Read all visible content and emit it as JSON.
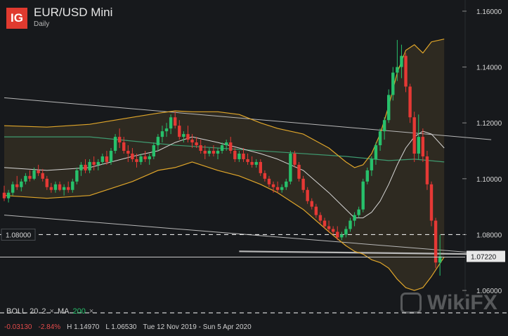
{
  "header": {
    "logo": "IG",
    "title": "EUR/USD Mini",
    "timeframe": "Daily"
  },
  "indicators": {
    "boll_name": "BOLL",
    "boll_period": "20",
    "boll_dev": "2",
    "ma_name": "MA",
    "ma_period": "200",
    "remove_symbol": "×"
  },
  "stats": {
    "change": "-0.03130",
    "change_pct": "-2.84%",
    "high": "H 1.14970",
    "low": "L 1.06530",
    "range": "Tue 12 Nov 2019 - Sun 5 Apr 2020"
  },
  "watermark": "WikiFX",
  "colors": {
    "background": "#17191c",
    "up": "#27c06b",
    "down": "#e53935",
    "band": "#e0a62a",
    "ma": "#3f9a70",
    "mid": "#d6d6d6",
    "trendline": "#b8b8b8"
  },
  "chart_data": {
    "type": "candlestick",
    "instrument": "EUR/USD Mini",
    "timeframe": "Daily",
    "y_axis": {
      "ticks": [
        "1.16000",
        "1.14000",
        "1.12000",
        "1.10000",
        "1.08000",
        "1.06000"
      ],
      "ylim": [
        1.056,
        1.164
      ]
    },
    "price_labels": {
      "left_level": "1.08000",
      "current": "1.07220"
    },
    "levels": [
      1.08
    ],
    "candles": [
      [
        1.095,
        1.0975,
        1.092,
        1.093
      ],
      [
        1.093,
        1.096,
        1.0915,
        1.095
      ],
      [
        1.095,
        1.099,
        1.094,
        1.098
      ],
      [
        1.098,
        1.101,
        1.096,
        1.097
      ],
      [
        1.097,
        1.1,
        1.0955,
        1.099
      ],
      [
        1.099,
        1.102,
        1.098,
        1.101
      ],
      [
        1.101,
        1.103,
        1.099,
        1.1
      ],
      [
        1.1,
        1.104,
        1.0995,
        1.103
      ],
      [
        1.103,
        1.105,
        1.101,
        1.102
      ],
      [
        1.102,
        1.1035,
        1.099,
        1.1
      ],
      [
        1.1,
        1.101,
        1.096,
        1.097
      ],
      [
        1.097,
        1.0985,
        1.095,
        1.096
      ],
      [
        1.096,
        1.099,
        1.095,
        1.098
      ],
      [
        1.098,
        1.099,
        1.0955,
        1.096
      ],
      [
        1.096,
        1.098,
        1.094,
        1.097
      ],
      [
        1.097,
        1.099,
        1.095,
        1.096
      ],
      [
        1.096,
        1.1,
        1.095,
        1.099
      ],
      [
        1.099,
        1.104,
        1.098,
        1.103
      ],
      [
        1.103,
        1.106,
        1.101,
        1.105
      ],
      [
        1.105,
        1.107,
        1.102,
        1.103
      ],
      [
        1.103,
        1.107,
        1.102,
        1.106
      ],
      [
        1.106,
        1.108,
        1.103,
        1.105
      ],
      [
        1.105,
        1.107,
        1.103,
        1.106
      ],
      [
        1.106,
        1.109,
        1.105,
        1.108
      ],
      [
        1.108,
        1.11,
        1.105,
        1.106
      ],
      [
        1.106,
        1.111,
        1.105,
        1.11
      ],
      [
        1.11,
        1.116,
        1.109,
        1.115
      ],
      [
        1.115,
        1.118,
        1.111,
        1.113
      ],
      [
        1.113,
        1.115,
        1.109,
        1.11
      ],
      [
        1.11,
        1.112,
        1.106,
        1.109
      ],
      [
        1.109,
        1.111,
        1.106,
        1.107
      ],
      [
        1.107,
        1.109,
        1.104,
        1.106
      ],
      [
        1.106,
        1.109,
        1.105,
        1.108
      ],
      [
        1.108,
        1.11,
        1.106,
        1.107
      ],
      [
        1.107,
        1.109,
        1.105,
        1.108
      ],
      [
        1.108,
        1.113,
        1.107,
        1.112
      ],
      [
        1.112,
        1.116,
        1.11,
        1.115
      ],
      [
        1.115,
        1.119,
        1.113,
        1.117
      ],
      [
        1.117,
        1.12,
        1.115,
        1.118
      ],
      [
        1.118,
        1.123,
        1.116,
        1.122
      ],
      [
        1.122,
        1.124,
        1.118,
        1.119
      ],
      [
        1.119,
        1.121,
        1.114,
        1.115
      ],
      [
        1.115,
        1.117,
        1.113,
        1.116
      ],
      [
        1.116,
        1.119,
        1.113,
        1.114
      ],
      [
        1.114,
        1.116,
        1.111,
        1.113
      ],
      [
        1.113,
        1.115,
        1.111,
        1.112
      ],
      [
        1.112,
        1.114,
        1.109,
        1.11
      ],
      [
        1.11,
        1.112,
        1.107,
        1.109
      ],
      [
        1.109,
        1.111,
        1.108,
        1.11
      ],
      [
        1.11,
        1.112,
        1.108,
        1.109
      ],
      [
        1.109,
        1.111,
        1.107,
        1.11
      ],
      [
        1.11,
        1.113,
        1.109,
        1.112
      ],
      [
        1.112,
        1.114,
        1.11,
        1.113
      ],
      [
        1.113,
        1.115,
        1.109,
        1.11
      ],
      [
        1.11,
        1.111,
        1.106,
        1.107
      ],
      [
        1.107,
        1.11,
        1.106,
        1.109
      ],
      [
        1.109,
        1.111,
        1.106,
        1.107
      ],
      [
        1.107,
        1.109,
        1.105,
        1.106
      ],
      [
        1.106,
        1.108,
        1.104,
        1.105
      ],
      [
        1.105,
        1.107,
        1.104,
        1.106
      ],
      [
        1.106,
        1.107,
        1.101,
        1.102
      ],
      [
        1.102,
        1.103,
        1.099,
        1.1
      ],
      [
        1.1,
        1.101,
        1.097,
        1.098
      ],
      [
        1.098,
        1.099,
        1.095,
        1.097
      ],
      [
        1.097,
        1.099,
        1.095,
        1.096
      ],
      [
        1.096,
        1.098,
        1.095,
        1.097
      ],
      [
        1.097,
        1.1,
        1.096,
        1.099
      ],
      [
        1.099,
        1.11,
        1.098,
        1.109
      ],
      [
        1.109,
        1.11,
        1.104,
        1.105
      ],
      [
        1.105,
        1.106,
        1.099,
        1.1
      ],
      [
        1.1,
        1.101,
        1.095,
        1.096
      ],
      [
        1.096,
        1.097,
        1.091,
        1.092
      ],
      [
        1.092,
        1.093,
        1.089,
        1.09
      ],
      [
        1.09,
        1.091,
        1.086,
        1.087
      ],
      [
        1.087,
        1.088,
        1.084,
        1.085
      ],
      [
        1.085,
        1.086,
        1.082,
        1.083
      ],
      [
        1.083,
        1.085,
        1.081,
        1.082
      ],
      [
        1.082,
        1.083,
        1.08,
        1.081
      ],
      [
        1.081,
        1.083,
        1.078,
        1.079
      ],
      [
        1.079,
        1.081,
        1.078,
        1.08
      ],
      [
        1.08,
        1.083,
        1.079,
        1.082
      ],
      [
        1.082,
        1.086,
        1.081,
        1.085
      ],
      [
        1.085,
        1.088,
        1.083,
        1.087
      ],
      [
        1.087,
        1.09,
        1.086,
        1.089
      ],
      [
        1.089,
        1.1,
        1.088,
        1.099
      ],
      [
        1.099,
        1.104,
        1.098,
        1.103
      ],
      [
        1.103,
        1.108,
        1.101,
        1.107
      ],
      [
        1.107,
        1.113,
        1.105,
        1.112
      ],
      [
        1.112,
        1.118,
        1.11,
        1.117
      ],
      [
        1.117,
        1.122,
        1.114,
        1.121
      ],
      [
        1.121,
        1.132,
        1.12,
        1.13
      ],
      [
        1.13,
        1.14,
        1.128,
        1.138
      ],
      [
        1.138,
        1.1497,
        1.135,
        1.14
      ],
      [
        1.14,
        1.148,
        1.136,
        1.144
      ],
      [
        1.144,
        1.145,
        1.131,
        1.133
      ],
      [
        1.133,
        1.134,
        1.12,
        1.122
      ],
      [
        1.122,
        1.124,
        1.106,
        1.109
      ],
      [
        1.109,
        1.123,
        1.107,
        1.115
      ],
      [
        1.115,
        1.118,
        1.106,
        1.108
      ],
      [
        1.108,
        1.11,
        1.096,
        1.098
      ],
      [
        1.098,
        1.099,
        1.083,
        1.085
      ],
      [
        1.085,
        1.086,
        1.068,
        1.07
      ],
      [
        1.07,
        1.08,
        1.0653,
        1.0722
      ]
    ],
    "bollinger": {
      "period": 20,
      "deviation": 2,
      "upper": [
        [
          0,
          1.119
        ],
        [
          10,
          1.1185
        ],
        [
          20,
          1.1195
        ],
        [
          30,
          1.122
        ],
        [
          36,
          1.1235
        ],
        [
          40,
          1.1243
        ],
        [
          44,
          1.124
        ],
        [
          50,
          1.124
        ],
        [
          55,
          1.123
        ],
        [
          60,
          1.12
        ],
        [
          64,
          1.118
        ],
        [
          70,
          1.116
        ],
        [
          76,
          1.111
        ],
        [
          80,
          1.106
        ],
        [
          82,
          1.104
        ],
        [
          84,
          1.105
        ],
        [
          86,
          1.109
        ],
        [
          88,
          1.116
        ],
        [
          90,
          1.126
        ],
        [
          92,
          1.138
        ],
        [
          94,
          1.146
        ],
        [
          96,
          1.148
        ],
        [
          98,
          1.145
        ],
        [
          100,
          1.149
        ],
        [
          103,
          1.15
        ]
      ],
      "mid": [
        [
          0,
          1.104
        ],
        [
          10,
          1.103
        ],
        [
          20,
          1.104
        ],
        [
          30,
          1.108
        ],
        [
          36,
          1.11
        ],
        [
          40,
          1.113
        ],
        [
          44,
          1.115
        ],
        [
          50,
          1.113
        ],
        [
          55,
          1.111
        ],
        [
          60,
          1.109
        ],
        [
          64,
          1.107
        ],
        [
          70,
          1.103
        ],
        [
          76,
          1.095
        ],
        [
          80,
          1.089
        ],
        [
          82,
          1.086
        ],
        [
          84,
          1.086
        ],
        [
          86,
          1.088
        ],
        [
          88,
          1.092
        ],
        [
          90,
          1.098
        ],
        [
          92,
          1.105
        ],
        [
          94,
          1.111
        ],
        [
          96,
          1.115
        ],
        [
          98,
          1.117
        ],
        [
          100,
          1.116
        ],
        [
          103,
          1.111
        ]
      ],
      "lower": [
        [
          0,
          1.094
        ],
        [
          10,
          1.093
        ],
        [
          20,
          1.094
        ],
        [
          30,
          1.099
        ],
        [
          36,
          1.103
        ],
        [
          40,
          1.104
        ],
        [
          44,
          1.106
        ],
        [
          50,
          1.103
        ],
        [
          55,
          1.101
        ],
        [
          60,
          1.098
        ],
        [
          64,
          1.095
        ],
        [
          70,
          1.089
        ],
        [
          76,
          1.081
        ],
        [
          80,
          1.076
        ],
        [
          82,
          1.074
        ],
        [
          84,
          1.073
        ],
        [
          86,
          1.071
        ],
        [
          88,
          1.07
        ],
        [
          90,
          1.068
        ],
        [
          92,
          1.064
        ],
        [
          94,
          1.061
        ],
        [
          96,
          1.06
        ],
        [
          98,
          1.061
        ],
        [
          100,
          1.065
        ],
        [
          103,
          1.072
        ]
      ]
    },
    "ma200": [
      [
        0,
        1.115
      ],
      [
        20,
        1.115
      ],
      [
        40,
        1.112
      ],
      [
        60,
        1.11
      ],
      [
        80,
        1.108
      ],
      [
        90,
        1.1065
      ],
      [
        96,
        1.107
      ],
      [
        103,
        1.106
      ]
    ],
    "trendlines": [
      {
        "from": [
          0,
          1.129
        ],
        "to": [
          114,
          1.114
        ]
      },
      {
        "from": [
          0,
          1.087
        ],
        "to": [
          114,
          1.073
        ]
      },
      {
        "from": [
          55,
          1.074
        ],
        "to": [
          112,
          1.073
        ]
      }
    ]
  }
}
